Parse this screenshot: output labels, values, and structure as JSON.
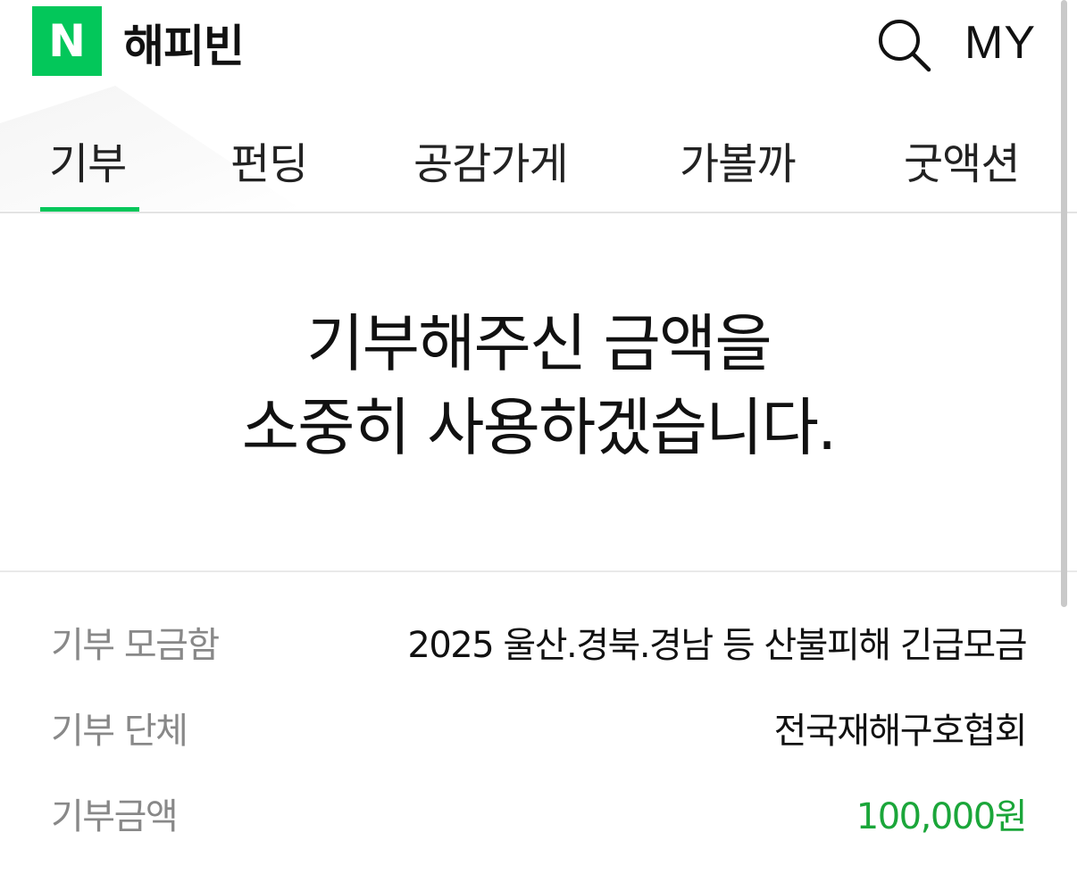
{
  "header": {
    "logo_letter": "N",
    "brand": "해피빈",
    "search_icon": "search-icon",
    "my_label": "MY",
    "accent_color": "#03c75a"
  },
  "tabs": [
    {
      "label": "기부",
      "active": true
    },
    {
      "label": "펀딩",
      "active": false
    },
    {
      "label": "공감가게",
      "active": false
    },
    {
      "label": "가볼까",
      "active": false
    },
    {
      "label": "굿액션",
      "active": false
    }
  ],
  "message": {
    "line1": "기부해주신 금액을",
    "line2": "소중히 사용하겠습니다."
  },
  "details": [
    {
      "label": "기부 모금함",
      "value": "2025 울산.경북.경남 등 산불피해 긴급모금"
    },
    {
      "label": "기부 단체",
      "value": "전국재해구호협회"
    },
    {
      "label": "기부금액",
      "value": "100,000원"
    }
  ]
}
